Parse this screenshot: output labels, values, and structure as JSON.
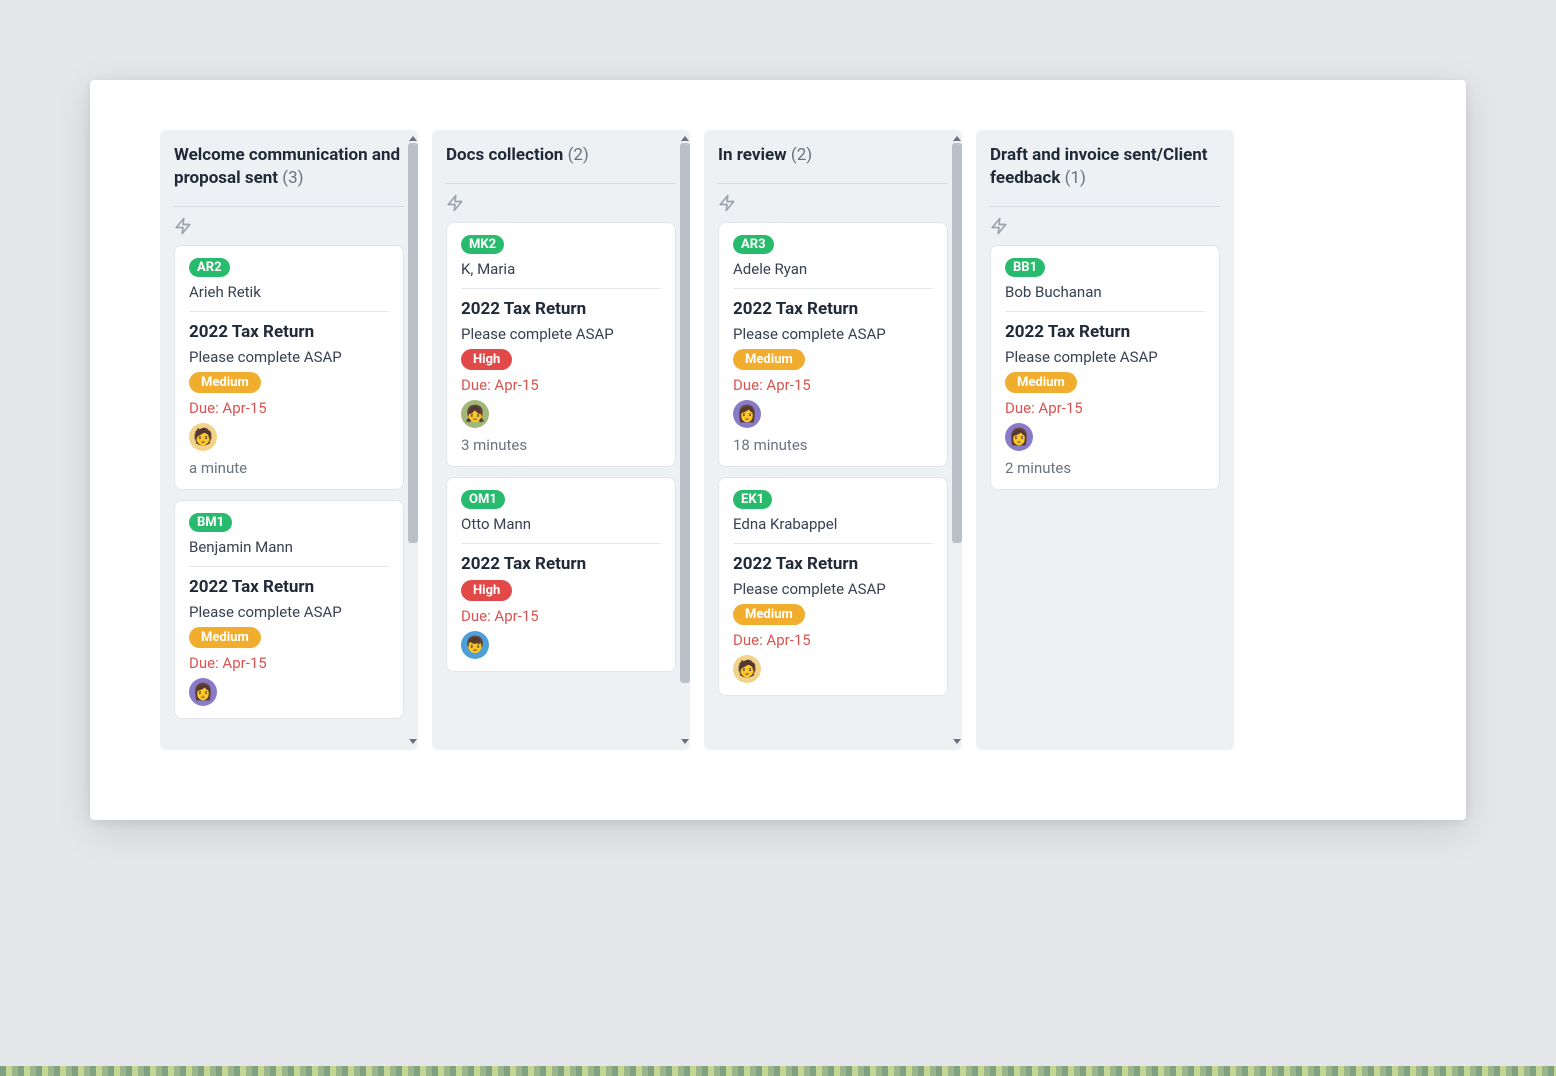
{
  "columns": [
    {
      "title": "Welcome communication and proposal sent",
      "count": "(3)",
      "showScroll": true,
      "thumbHeight": 400,
      "cards": [
        {
          "code": "AR2",
          "client": "Arieh Retik",
          "title": "2022 Tax Return",
          "desc": "Please complete ASAP",
          "priority": "Medium",
          "priorityClass": "priority-medium",
          "due": "Due: Apr-15",
          "avatar": "avatar-homer",
          "avatarGlyph": "🧑",
          "time": "a minute"
        },
        {
          "code": "BM1",
          "client": "Benjamin Mann",
          "title": "2022 Tax Return",
          "desc": "Please complete ASAP",
          "priority": "Medium",
          "priorityClass": "priority-medium",
          "due": "Due: Apr-15",
          "avatar": "avatar-marge",
          "avatarGlyph": "👩",
          "time": ""
        }
      ]
    },
    {
      "title": "Docs collection",
      "count": "(2)",
      "showScroll": true,
      "thumbHeight": 540,
      "cards": [
        {
          "code": "MK2",
          "client": "K, Maria",
          "title": "2022 Tax Return",
          "desc": "Please complete ASAP",
          "priority": "High",
          "priorityClass": "priority-high",
          "due": "Due: Apr-15",
          "avatar": "avatar-lisa",
          "avatarGlyph": "👧",
          "time": "3 minutes"
        },
        {
          "code": "OM1",
          "client": "Otto Mann",
          "title": "2022 Tax Return",
          "desc": "",
          "priority": "High",
          "priorityClass": "priority-high",
          "due": "Due: Apr-15",
          "avatar": "avatar-bart",
          "avatarGlyph": "👦",
          "time": ""
        }
      ]
    },
    {
      "title": "In review",
      "count": "(2)",
      "showScroll": true,
      "thumbHeight": 400,
      "cards": [
        {
          "code": "AR3",
          "client": "Adele Ryan",
          "title": "2022 Tax Return",
          "desc": "Please complete ASAP",
          "priority": "Medium",
          "priorityClass": "priority-medium",
          "due": "Due: Apr-15",
          "avatar": "avatar-marge",
          "avatarGlyph": "👩",
          "time": "18 minutes"
        },
        {
          "code": "EK1",
          "client": "Edna Krabappel",
          "title": "2022 Tax Return",
          "desc": "Please complete ASAP",
          "priority": "Medium",
          "priorityClass": "priority-medium",
          "due": "Due: Apr-15",
          "avatar": "avatar-homer",
          "avatarGlyph": "🧑",
          "time": ""
        }
      ]
    },
    {
      "title": "Draft and invoice sent/Client feedback",
      "count": "(1)",
      "showScroll": false,
      "thumbHeight": 0,
      "cards": [
        {
          "code": "BB1",
          "client": "Bob Buchanan",
          "title": "2022 Tax Return",
          "desc": "Please complete ASAP",
          "priority": "Medium",
          "priorityClass": "priority-medium",
          "due": "Due: Apr-15",
          "avatar": "avatar-marge",
          "avatarGlyph": "👩",
          "time": "2 minutes"
        }
      ]
    }
  ]
}
